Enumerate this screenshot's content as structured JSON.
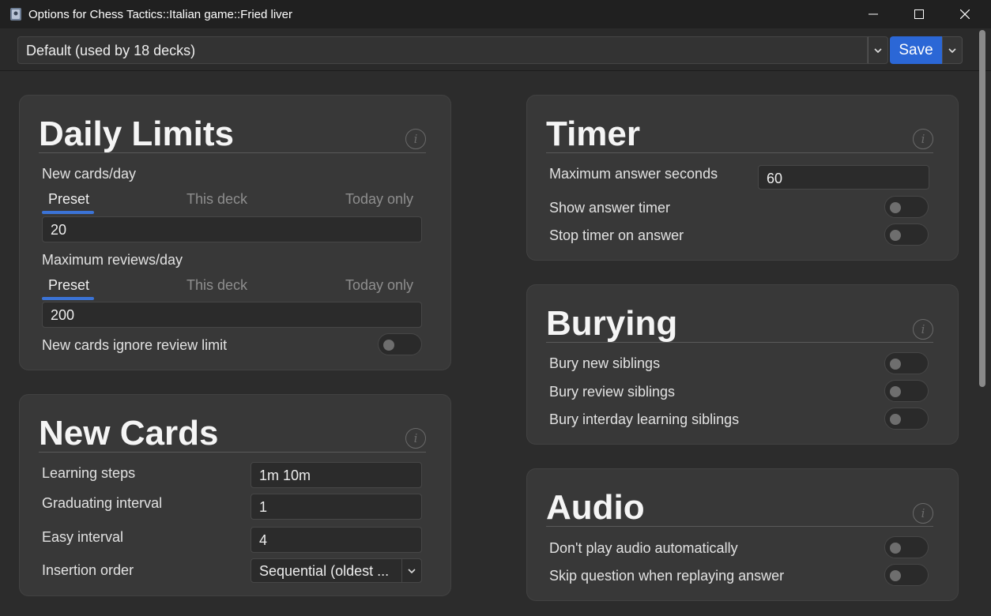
{
  "window": {
    "title": "Options for Chess Tactics::Italian game::Fried liver"
  },
  "preset_bar": {
    "selected_preset": "Default (used by 18 decks)",
    "save_label": "Save"
  },
  "daily_limits": {
    "title": "Daily Limits",
    "new_cards_label": "New cards/day",
    "new_cards_tabs": [
      "Preset",
      "This deck",
      "Today only"
    ],
    "new_cards_value": "20",
    "max_reviews_label": "Maximum reviews/day",
    "max_reviews_tabs": [
      "Preset",
      "This deck",
      "Today only"
    ],
    "max_reviews_value": "200",
    "ignore_review_limit_label": "New cards ignore review limit",
    "ignore_review_limit_on": false
  },
  "new_cards": {
    "title": "New Cards",
    "learning_steps_label": "Learning steps",
    "learning_steps_value": "1m 10m",
    "graduating_interval_label": "Graduating interval",
    "graduating_interval_value": "1",
    "easy_interval_label": "Easy interval",
    "easy_interval_value": "4",
    "insertion_order_label": "Insertion order",
    "insertion_order_value": "Sequential (oldest ..."
  },
  "timer": {
    "title": "Timer",
    "max_answer_seconds_label": "Maximum answer seconds",
    "max_answer_seconds_value": "60",
    "show_answer_timer_label": "Show answer timer",
    "stop_timer_label": "Stop timer on answer"
  },
  "burying": {
    "title": "Burying",
    "bury_new_label": "Bury new siblings",
    "bury_review_label": "Bury review siblings",
    "bury_interday_label": "Bury interday learning siblings"
  },
  "audio": {
    "title": "Audio",
    "dont_play_label": "Don't play audio automatically",
    "skip_question_label": "Skip question when replaying answer"
  },
  "colors": {
    "accent": "#2b67d6",
    "tab_underline": "#3b73d6",
    "card_bg": "#383838",
    "window_bg": "#2c2c2c"
  },
  "icons": [
    "app-icon",
    "minimize-icon",
    "maximize-icon",
    "close-icon",
    "chevron-down-icon",
    "info-icon"
  ]
}
